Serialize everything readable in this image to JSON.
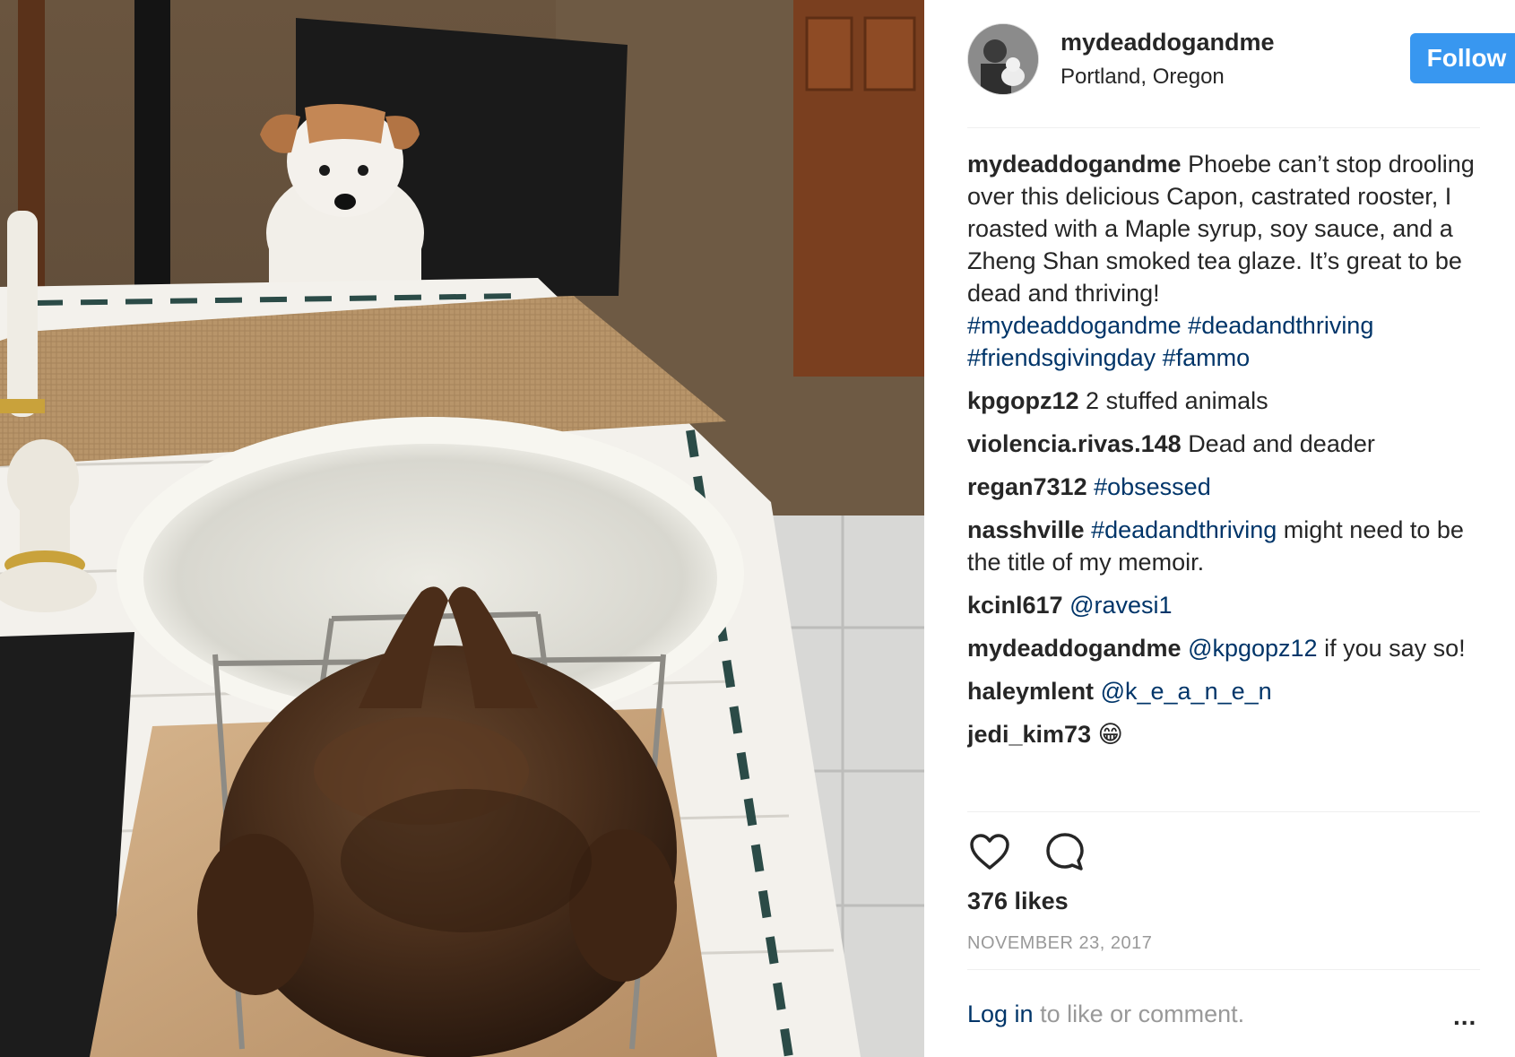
{
  "post": {
    "username": "mydeaddogandme",
    "location": "Portland, Oregon",
    "follow_label": "Follow",
    "likes": "376 likes",
    "date": "NOVEMBER 23, 2017"
  },
  "caption": {
    "username": "mydeaddogandme",
    "text": "Phoebe can’t stop drooling over this delicious Capon, castrated rooster, I roasted with a Maple syrup, soy sauce, and a Zheng Shan smoked tea glaze. It’s great to be dead and thriving!",
    "hashtags": "#mydeaddogandme #deadandthriving #friendsgivingday #fammo"
  },
  "comments": [
    {
      "user": "kpgopz12",
      "text": "2 stuffed animals"
    },
    {
      "user": "violencia.rivas.148",
      "text": "Dead and deader"
    },
    {
      "user": "regan7312",
      "tag": "#obsessed"
    },
    {
      "user": "nasshville",
      "tag": "#deadandthriving",
      "text": "might need to be the title of my memoir."
    },
    {
      "user": "kcinl617",
      "tag": "@ravesi1"
    },
    {
      "user": "mydeaddogandme",
      "tag": "@kpgopz12",
      "text": "if you say so!"
    },
    {
      "user": "haleymlent",
      "tag": "@k_e_a_n_e_n"
    },
    {
      "user": "jedi_kim73",
      "text": "😁"
    }
  ],
  "footer": {
    "login_link": "Log in",
    "login_rest": "to like or comment.",
    "more": "..."
  },
  "icons": {
    "like": "heart-icon",
    "comment": "comment-bubble-icon",
    "more": "more-options-icon"
  },
  "colors": {
    "follow_button": "#3897f0",
    "link": "#003569",
    "muted": "#999999"
  }
}
